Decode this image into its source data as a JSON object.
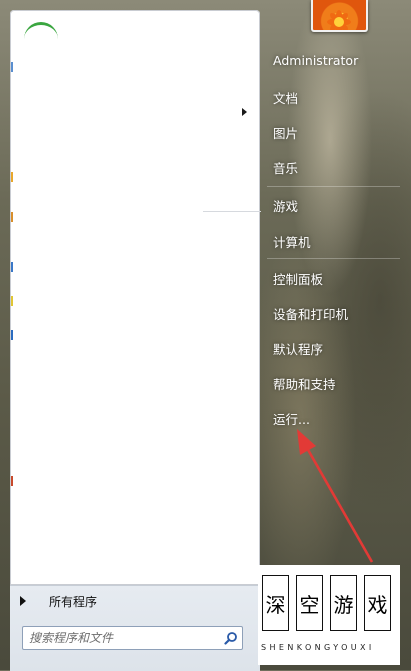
{
  "user": {
    "name": "Administrator"
  },
  "right_menu": [
    {
      "label": "文档"
    },
    {
      "label": "图片"
    },
    {
      "label": "音乐"
    },
    {
      "label": "游戏"
    },
    {
      "label": "计算机"
    },
    {
      "label": "控制面板"
    },
    {
      "label": "设备和打印机"
    },
    {
      "label": "默认程序"
    },
    {
      "label": "帮助和支持"
    },
    {
      "label": "运行..."
    }
  ],
  "left": {
    "all_programs": "所有程序",
    "search_placeholder": "搜索程序和文件"
  },
  "watermark": {
    "chars": [
      "深",
      "空",
      "游",
      "戏"
    ],
    "subtitle": "SHENKONGYOUXI"
  },
  "colors": {
    "annotation": "#e23a36",
    "accent_green": "#3aa640"
  }
}
